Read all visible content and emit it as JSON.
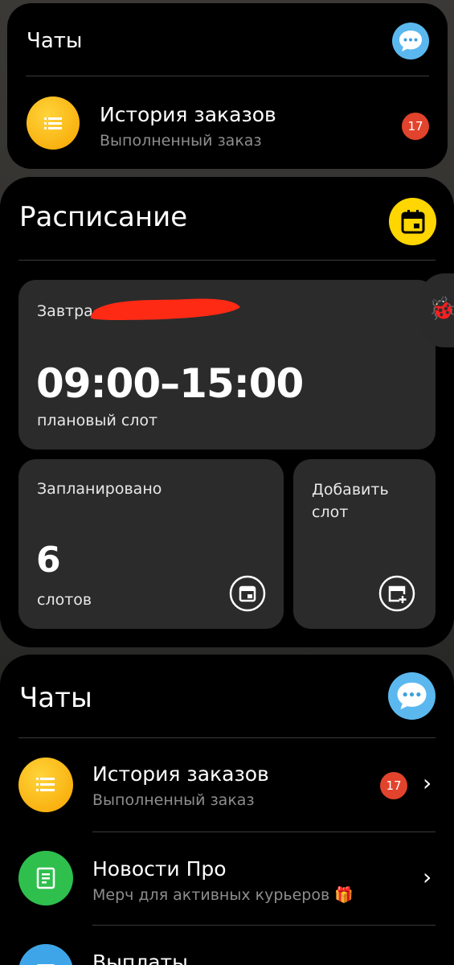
{
  "mini_chats": {
    "title": "Чаты",
    "item": {
      "title": "История заказов",
      "subtitle": "Выполненный заказ",
      "badge": "17"
    }
  },
  "schedule": {
    "title": "Расписание",
    "tomorrow_label": "Завтра,",
    "slot_time": "09:00–15:00",
    "slot_caption": "плановый слот",
    "planned_label": "Запланировано",
    "planned_count": "6",
    "planned_unit": "слотов",
    "add_slot_label": "Добавить слот"
  },
  "chats": {
    "title": "Чаты",
    "items": [
      {
        "title": "История заказов",
        "subtitle": "Выполненный заказ",
        "badge": "17",
        "icon": "list-icon",
        "color": "#f7a400"
      },
      {
        "title": "Новости Про",
        "subtitle": "Мерч для активных курьеров 🎁",
        "icon": "document-icon",
        "color": "#2fbf4d"
      },
      {
        "title": "Выплаты",
        "subtitle": "",
        "icon": "wallet-icon",
        "color": "#3ea6e8"
      }
    ]
  },
  "colors": {
    "accent_yellow": "#ffd600",
    "badge_red": "#e2432c",
    "chat_blue": "#3ea6e8"
  }
}
